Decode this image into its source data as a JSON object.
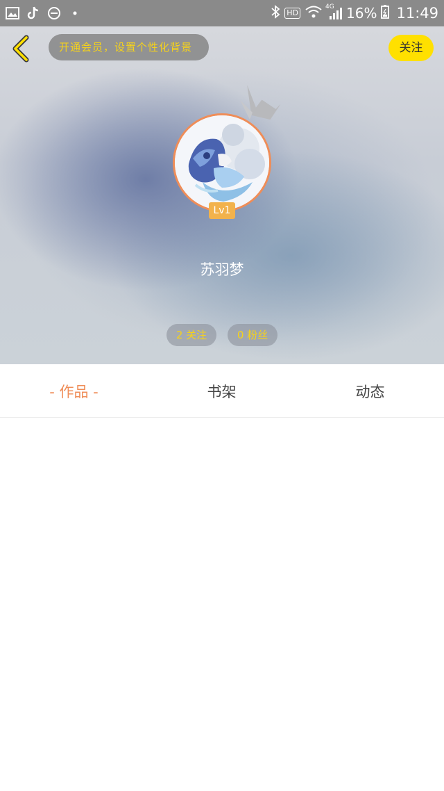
{
  "status_bar": {
    "battery_percent": "16%",
    "time": "11:49",
    "hd_label": "HD",
    "network_label": "4G",
    "left_icons": [
      "image-icon",
      "tiktok-icon",
      "dnd-icon",
      "dot-icon"
    ],
    "right_icons": [
      "bluetooth-icon",
      "hd-icon",
      "wifi-icon",
      "signal-icon",
      "battery-icon"
    ]
  },
  "header": {
    "vip_banner": "开通会员，设置个性化背景",
    "follow_button": "关注",
    "level": "Lv1",
    "username": "苏羽梦",
    "following": "2 关注",
    "fans": "0 粉丝"
  },
  "tabs": [
    {
      "label": "- 作品 -",
      "active": true
    },
    {
      "label": "书架",
      "active": false
    },
    {
      "label": "动态",
      "active": false
    }
  ],
  "colors": {
    "accent_yellow": "#ffe000",
    "accent_orange": "#ef8d58",
    "level_badge": "#f2b24c"
  }
}
